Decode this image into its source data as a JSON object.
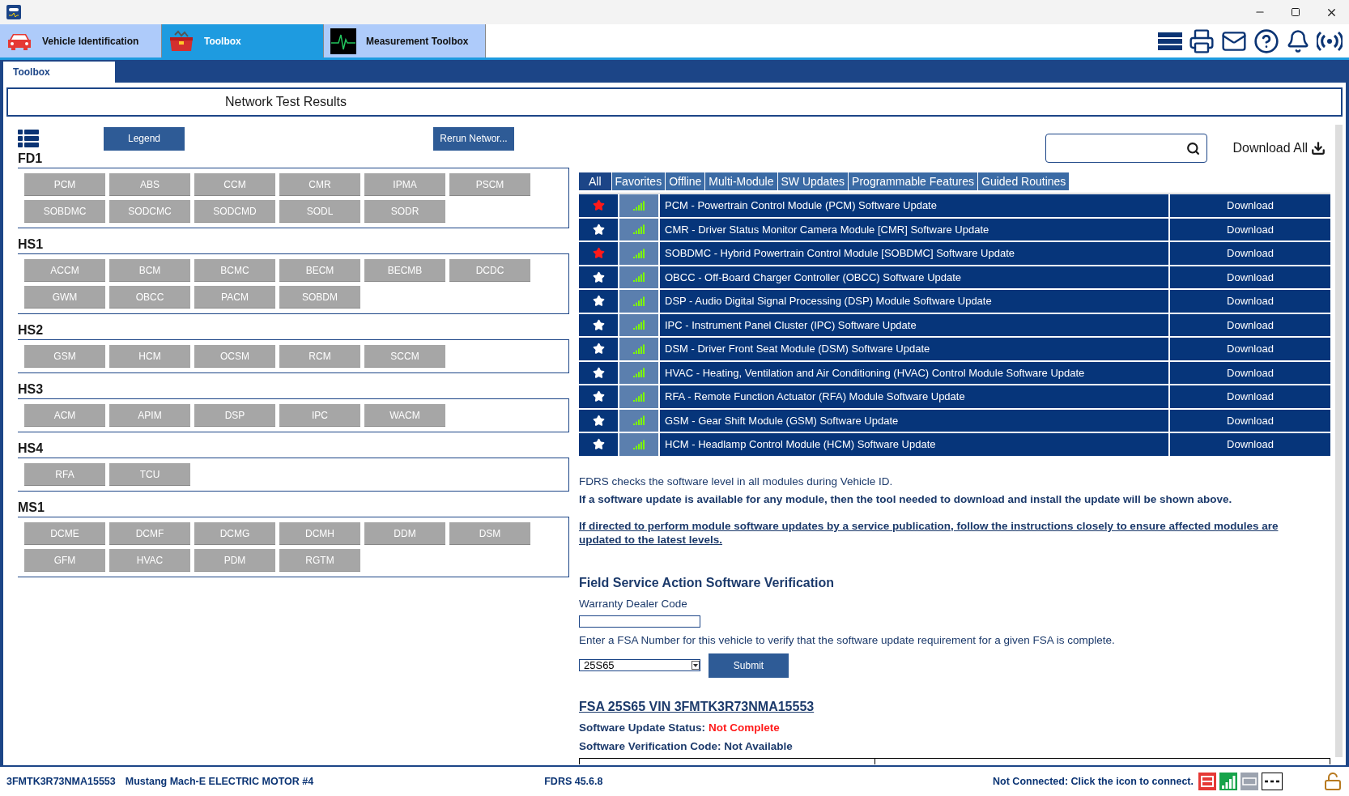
{
  "app_tabs": [
    {
      "label": "Vehicle Identification",
      "kind": "car",
      "selected": false
    },
    {
      "label": "Toolbox",
      "kind": "toolbox",
      "selected": true
    },
    {
      "label": "Measurement Toolbox",
      "kind": "scope",
      "selected": false
    }
  ],
  "sub_tabs": [
    {
      "label": "Toolbox",
      "selected": true
    }
  ],
  "page_title": "Network Test Results",
  "left_panel": {
    "legend_button": "Legend",
    "rerun_button": "Rerun Networ...",
    "networks": [
      {
        "name": "FD1",
        "modules": [
          "PCM",
          "ABS",
          "CCM",
          "CMR",
          "IPMA",
          "PSCM",
          "SOBDMC",
          "SODCMC",
          "SODCMD",
          "SODL",
          "SODR"
        ]
      },
      {
        "name": "HS1",
        "modules": [
          "ACCM",
          "BCM",
          "BCMC",
          "BECM",
          "BECMB",
          "DCDC",
          "GWM",
          "OBCC",
          "PACM",
          "SOBDM"
        ]
      },
      {
        "name": "HS2",
        "modules": [
          "GSM",
          "HCM",
          "OCSM",
          "RCM",
          "SCCM"
        ]
      },
      {
        "name": "HS3",
        "modules": [
          "ACM",
          "APIM",
          "DSP",
          "IPC",
          "WACM"
        ]
      },
      {
        "name": "HS4",
        "modules": [
          "RFA",
          "TCU"
        ]
      },
      {
        "name": "MS1",
        "modules": [
          "DCME",
          "DCMF",
          "DCMG",
          "DCMH",
          "DDM",
          "DSM",
          "GFM",
          "HVAC",
          "PDM",
          "RGTM"
        ]
      }
    ]
  },
  "right_panel": {
    "download_all": "Download All",
    "filter_tabs": [
      {
        "label": "All",
        "selected": true
      },
      {
        "label": "Favorites",
        "selected": false
      },
      {
        "label": "Offline",
        "selected": false
      },
      {
        "label": "Multi-Module",
        "selected": false
      },
      {
        "label": "SW Updates",
        "selected": false
      },
      {
        "label": "Programmable Features",
        "selected": false
      },
      {
        "label": "Guided Routines",
        "selected": false
      }
    ],
    "rows": [
      {
        "favorite": true,
        "description": "PCM - Powertrain Control Module (PCM) Software Update",
        "action": "Download"
      },
      {
        "favorite": false,
        "description": "CMR - Driver Status Monitor Camera Module [CMR] Software Update",
        "action": "Download"
      },
      {
        "favorite": true,
        "description": "SOBDMC - Hybrid Powertrain Control Module [SOBDMC] Software Update",
        "action": "Download"
      },
      {
        "favorite": false,
        "description": "OBCC - Off-Board Charger Controller (OBCC) Software Update",
        "action": "Download"
      },
      {
        "favorite": false,
        "description": "DSP - Audio Digital Signal Processing (DSP) Module Software Update",
        "action": "Download"
      },
      {
        "favorite": false,
        "description": "IPC - Instrument Panel Cluster (IPC) Software Update",
        "action": "Download"
      },
      {
        "favorite": false,
        "description": "DSM - Driver Front Seat Module (DSM) Software Update",
        "action": "Download"
      },
      {
        "favorite": false,
        "description": "HVAC - Heating, Ventilation and Air Conditioning (HVAC) Control Module Software Update",
        "action": "Download"
      },
      {
        "favorite": false,
        "description": "RFA - Remote Function Actuator (RFA) Module Software Update",
        "action": "Download"
      },
      {
        "favorite": false,
        "description": "GSM - Gear Shift Module (GSM) Software Update",
        "action": "Download"
      },
      {
        "favorite": false,
        "description": "HCM - Headlamp Control Module (HCM) Software Update",
        "action": "Download"
      }
    ],
    "info_text": "FDRS checks the software level in all modules during Vehicle ID.",
    "info_bold": "If a software update is available for any module, then the tool needed to download and install the update will be shown above.",
    "info_link": "If directed to perform module software updates by a service publication, follow the instructions closely to ensure affected modules are updated to the latest levels.",
    "fsa": {
      "heading": "Field Service Action Software Verification",
      "dealer_label": "Warranty Dealer Code",
      "instruction": "Enter a FSA Number for this vehicle to verify that the software update requirement for a given FSA is complete.",
      "fsa_select": "25S65",
      "submit": "Submit",
      "result_link": "FSA 25S65 VIN 3FMTK3R73NMA15553",
      "status_label": "Software Update Status:",
      "status_value": "Not Complete",
      "code_line": "Software Verification Code: Not Available"
    }
  },
  "status_bar": {
    "vin": "3FMTK3R73NMA15553",
    "vehicle": "Mustang Mach-E ELECTRIC MOTOR #4",
    "version": "FDRS 45.6.8",
    "connection": "Not Connected: Click the icon to connect."
  }
}
